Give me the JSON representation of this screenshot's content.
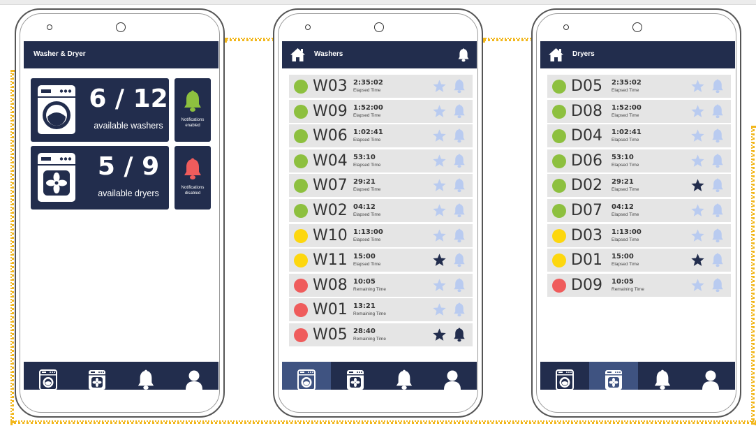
{
  "colors": {
    "navy": "#222d4d",
    "nav_active": "#3f5381",
    "green": "#8dc03f",
    "yellow": "#fdd70e",
    "red": "#ef5c5c",
    "light_icon": "#b9cbf0",
    "row_bg": "#e5e5e5",
    "dotted_connector": "#f2b71d"
  },
  "home_screen": {
    "header_title": "Washer & Dryer",
    "washers": {
      "count": "6 / 12",
      "label": "available washers",
      "icon": "washer-icon"
    },
    "dryers": {
      "count": "5 / 9",
      "label": "available dryers",
      "icon": "dryer-icon"
    },
    "washer_notifications": {
      "line1": "Notifications",
      "line2": "enabled",
      "icon": "bell-icon",
      "state": "enabled"
    },
    "dryer_notifications": {
      "line1": "Notifications",
      "line2": "disabled",
      "icon": "bell-icon",
      "state": "disabled"
    },
    "nav": {
      "items": [
        "washer-icon",
        "dryer-icon",
        "bell-icon",
        "user-icon"
      ],
      "active": -1
    }
  },
  "washers_screen": {
    "header_title": "Washers",
    "header_icons": [
      "home-icon",
      "bell-icon"
    ],
    "rows": [
      {
        "id": "W03",
        "time": "2:35:02",
        "label": "Elapsed Time",
        "status": "green",
        "favorite": false,
        "notify": false
      },
      {
        "id": "W09",
        "time": "1:52:00",
        "label": "Elapsed Time",
        "status": "green",
        "favorite": false,
        "notify": false
      },
      {
        "id": "W06",
        "time": "1:02:41",
        "label": "Elapsed Time",
        "status": "green",
        "favorite": false,
        "notify": false
      },
      {
        "id": "W04",
        "time": "53:10",
        "label": "Elapsed Time",
        "status": "green",
        "favorite": false,
        "notify": false
      },
      {
        "id": "W07",
        "time": "29:21",
        "label": "Elapsed Time",
        "status": "green",
        "favorite": false,
        "notify": false
      },
      {
        "id": "W02",
        "time": "04:12",
        "label": "Elapsed Time",
        "status": "green",
        "favorite": false,
        "notify": false
      },
      {
        "id": "W10",
        "time": "1:13:00",
        "label": "Elapsed Time",
        "status": "yellow",
        "favorite": false,
        "notify": false
      },
      {
        "id": "W11",
        "time": "15:00",
        "label": "Elapsed Time",
        "status": "yellow",
        "favorite": true,
        "notify": false
      },
      {
        "id": "W08",
        "time": "10:05",
        "label": "Remaining Time",
        "status": "red",
        "favorite": false,
        "notify": false
      },
      {
        "id": "W01",
        "time": "13:21",
        "label": "Remaining Time",
        "status": "red",
        "favorite": false,
        "notify": false
      },
      {
        "id": "W05",
        "time": "28:40",
        "label": "Remaining Time",
        "status": "red",
        "favorite": true,
        "notify": true
      }
    ],
    "nav": {
      "items": [
        "washer-icon",
        "dryer-icon",
        "bell-icon",
        "user-icon"
      ],
      "active": 0
    }
  },
  "dryers_screen": {
    "header_title": "Dryers",
    "header_icons": [
      "home-icon"
    ],
    "rows": [
      {
        "id": "D05",
        "time": "2:35:02",
        "label": "Elapsed Time",
        "status": "green",
        "favorite": false,
        "notify": false
      },
      {
        "id": "D08",
        "time": "1:52:00",
        "label": "Elapsed Time",
        "status": "green",
        "favorite": false,
        "notify": false
      },
      {
        "id": "D04",
        "time": "1:02:41",
        "label": "Elapsed Time",
        "status": "green",
        "favorite": false,
        "notify": false
      },
      {
        "id": "D06",
        "time": "53:10",
        "label": "Elapsed Time",
        "status": "green",
        "favorite": false,
        "notify": false
      },
      {
        "id": "D02",
        "time": "29:21",
        "label": "Elapsed Time",
        "status": "green",
        "favorite": true,
        "notify": false
      },
      {
        "id": "D07",
        "time": "04:12",
        "label": "Elapsed Time",
        "status": "green",
        "favorite": false,
        "notify": false
      },
      {
        "id": "D03",
        "time": "1:13:00",
        "label": "Elapsed Time",
        "status": "yellow",
        "favorite": false,
        "notify": false
      },
      {
        "id": "D01",
        "time": "15:00",
        "label": "Elapsed Time",
        "status": "yellow",
        "favorite": true,
        "notify": false
      },
      {
        "id": "D09",
        "time": "10:05",
        "label": "Remaining Time",
        "status": "red",
        "favorite": false,
        "notify": false
      }
    ],
    "nav": {
      "items": [
        "washer-icon",
        "dryer-icon",
        "bell-icon",
        "user-icon"
      ],
      "active": 1
    }
  }
}
